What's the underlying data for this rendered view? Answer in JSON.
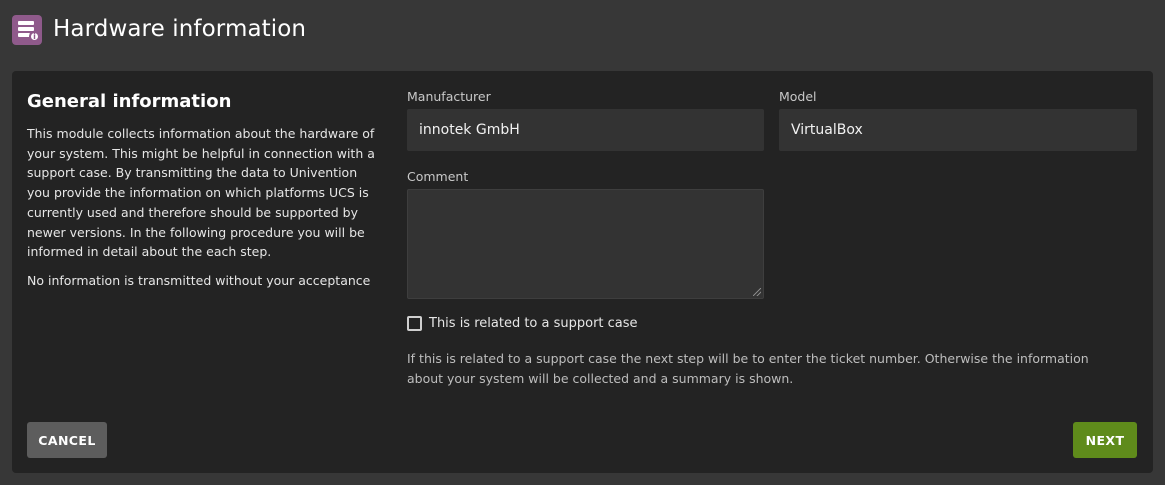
{
  "header": {
    "title": "Hardware information",
    "icon": "hardware-info-icon"
  },
  "general": {
    "title": "General information",
    "description": "This module collects information about the hardware of your system. This might be helpful in connection with a support case. By transmitting the data to Univention you provide the information on which platforms UCS is currently used and therefore should be supported by newer versions. In the following procedure you will be informed in detail about the each step.",
    "notice": "No information is transmitted without your acceptance"
  },
  "form": {
    "manufacturer_label": "Manufacturer",
    "manufacturer_value": "innotek GmbH",
    "model_label": "Model",
    "model_value": "VirtualBox",
    "comment_label": "Comment",
    "comment_value": "",
    "support_checkbox_label": "This is related to a support case",
    "support_checked": false,
    "hint": "If this is related to a support case the next step will be to enter the ticket number. Otherwise the information about your system will be collected and a summary is shown."
  },
  "buttons": {
    "cancel": "CANCEL",
    "next": "NEXT"
  },
  "colors": {
    "accent": "#5f8b1b",
    "icon": "#8f5a8b"
  }
}
